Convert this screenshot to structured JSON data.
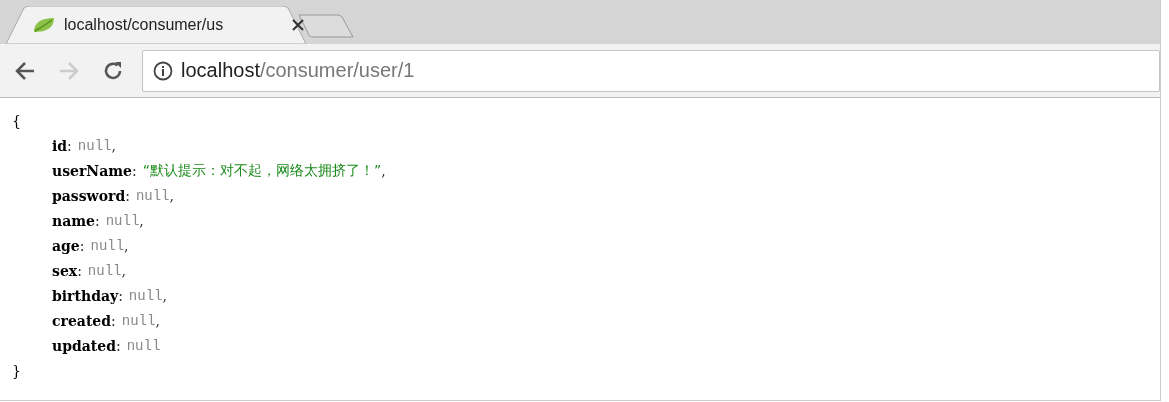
{
  "tab": {
    "title": "localhost/consumer/us"
  },
  "address_bar": {
    "host": "localhost",
    "path": "/consumer/user/1"
  },
  "document": {
    "open": "{",
    "close": "}",
    "entries": [
      {
        "key": "id",
        "colon": ":",
        "value": "null",
        "kind": "null",
        "comma": ","
      },
      {
        "key": "userName",
        "colon": ":",
        "value": "“默认提示：对不起，网络太拥挤了！”",
        "kind": "string",
        "comma": ","
      },
      {
        "key": "password",
        "colon": ":",
        "value": "null",
        "kind": "null",
        "comma": ","
      },
      {
        "key": "name",
        "colon": ":",
        "value": "null",
        "kind": "null",
        "comma": ","
      },
      {
        "key": "age",
        "colon": ":",
        "value": "null",
        "kind": "null",
        "comma": ","
      },
      {
        "key": "sex",
        "colon": ":",
        "value": "null",
        "kind": "null",
        "comma": ","
      },
      {
        "key": "birthday",
        "colon": ":",
        "value": "null",
        "kind": "null",
        "comma": ","
      },
      {
        "key": "created",
        "colon": ":",
        "value": "null",
        "kind": "null",
        "comma": ","
      },
      {
        "key": "updated",
        "colon": ":",
        "value": "null",
        "kind": "null"
      }
    ]
  }
}
